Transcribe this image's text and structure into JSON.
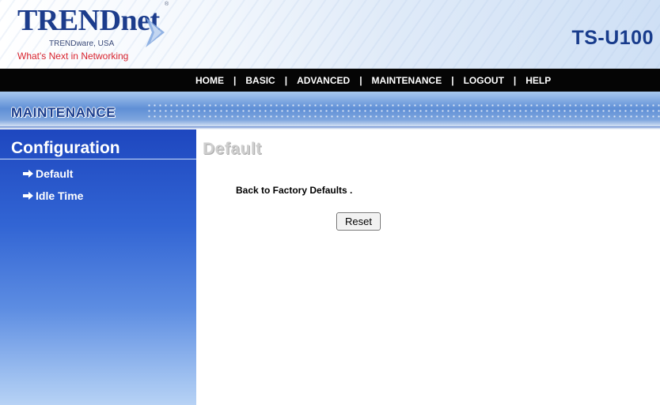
{
  "header": {
    "brand": "TRENDnet",
    "reg_mark": "®",
    "company": "TRENDware, USA",
    "tagline": "What's Next in Networking",
    "model": "TS-U100"
  },
  "nav": {
    "items": [
      "HOME",
      "BASIC",
      "ADVANCED",
      "MAINTENANCE",
      "LOGOUT",
      "HELP"
    ],
    "separator": "|"
  },
  "section": {
    "title": "MAINTENANCE"
  },
  "sidebar": {
    "heading": "Configuration",
    "items": [
      {
        "label": "Default",
        "icon": "arrow-right-icon"
      },
      {
        "label": "Idle Time",
        "icon": "arrow-right-icon"
      }
    ]
  },
  "main": {
    "title": "Default",
    "message": "Back to Factory Defaults .",
    "reset_button": "Reset"
  },
  "colors": {
    "brand_blue": "#1c3c8c",
    "tagline_red": "#d8242f",
    "nav_bg": "#050505",
    "sidebar_blue": "#2b5ccf"
  }
}
